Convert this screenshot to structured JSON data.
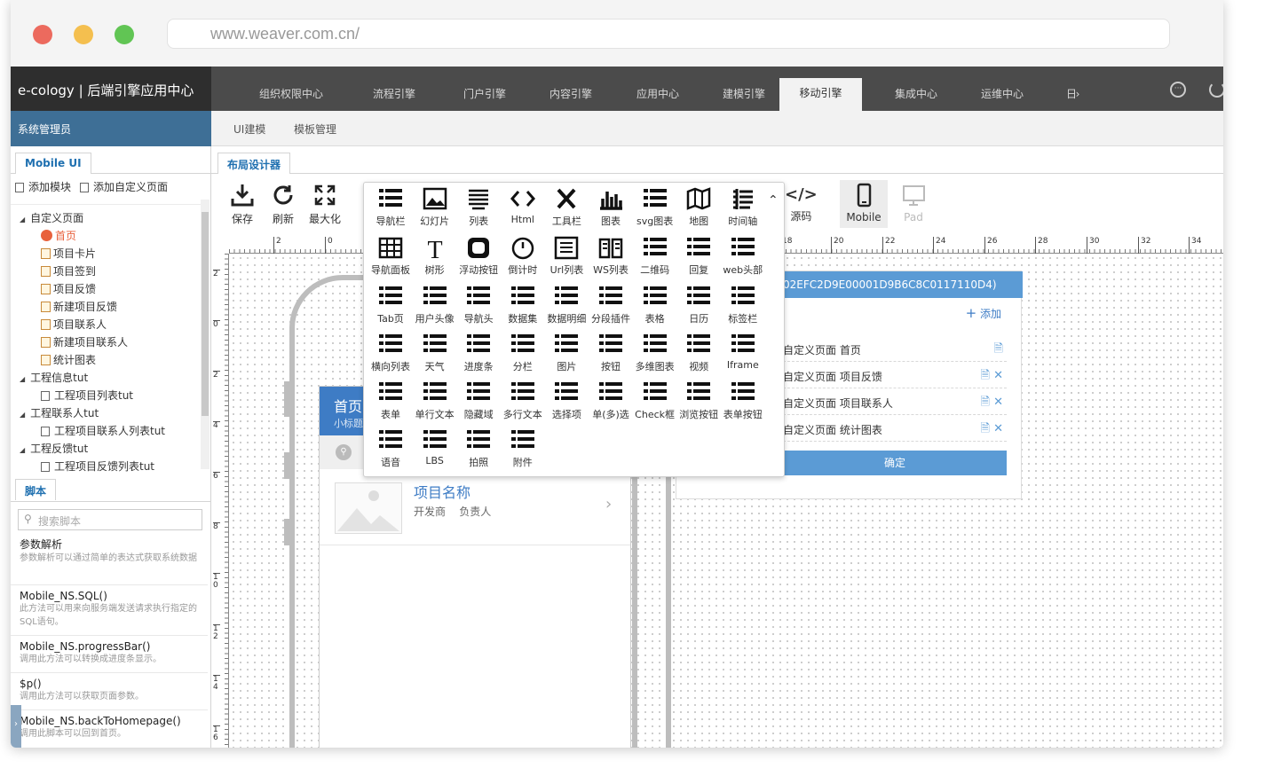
{
  "browser": {
    "url": "www.weaver.com.cn/"
  },
  "app": {
    "brand": "e-cology | 后端引擎应用中心",
    "user_menu": "系统管理员"
  },
  "nav": {
    "tabs": [
      "组织权限中心",
      "流程引擎",
      "门户引擎",
      "内容引擎",
      "应用中心",
      "建模引擎",
      "移动引擎",
      "集成中心",
      "运维中心",
      "日"
    ],
    "active_index": 6
  },
  "subnav": {
    "tabs": [
      "UI建模",
      "模板管理"
    ]
  },
  "left": {
    "tab": "Mobile UI",
    "actions": [
      "添加模块",
      "添加自定义页面"
    ],
    "tree": [
      {
        "label": "自定义页面",
        "level": 0,
        "kind": "group"
      },
      {
        "label": "首页",
        "level": 1,
        "kind": "home"
      },
      {
        "label": "项目卡片",
        "level": 1,
        "kind": "page"
      },
      {
        "label": "项目签到",
        "level": 1,
        "kind": "page"
      },
      {
        "label": "项目反馈",
        "level": 1,
        "kind": "page"
      },
      {
        "label": "新建项目反馈",
        "level": 1,
        "kind": "page"
      },
      {
        "label": "项目联系人",
        "level": 1,
        "kind": "page"
      },
      {
        "label": "新建项目联系人",
        "level": 1,
        "kind": "page"
      },
      {
        "label": "统计图表",
        "level": 1,
        "kind": "page"
      },
      {
        "label": "工程信息tut",
        "level": 0,
        "kind": "group"
      },
      {
        "label": "工程项目列表tut",
        "level": 1,
        "kind": "list"
      },
      {
        "label": "工程联系人tut",
        "level": 0,
        "kind": "group"
      },
      {
        "label": "工程项目联系人列表tut",
        "level": 1,
        "kind": "list"
      },
      {
        "label": "工程反馈tut",
        "level": 0,
        "kind": "group"
      },
      {
        "label": "工程项目反馈列表tut",
        "level": 1,
        "kind": "list"
      }
    ],
    "script_tab": "脚本",
    "search_placeholder": "搜索脚本",
    "scripts": [
      {
        "title": "参数解析",
        "desc": "参数解析可以通过简单的表达式获取系统数据"
      },
      {
        "title": "Mobile_NS.SQL()",
        "desc": "此方法可以用来向服务端发送请求执行指定的SQL语句。"
      },
      {
        "title": "Mobile_NS.progressBar()",
        "desc": "调用此方法可以转换成进度条显示。"
      },
      {
        "title": "$p()",
        "desc": "调用此方法可以获取页面参数。"
      },
      {
        "title": "Mobile_NS.backToHomepage()",
        "desc": "调用此脚本可以回到首页。"
      }
    ]
  },
  "designer": {
    "tab": "布局设计器",
    "toolbar": [
      "保存",
      "刷新",
      "最大化"
    ],
    "right_tools": [
      "源码",
      "Mobile",
      "Pad"
    ],
    "ruler_h": [
      "2",
      "0",
      "18",
      "20",
      "22",
      "24",
      "26",
      "28",
      "30",
      "32",
      "34"
    ],
    "ruler_v": [
      "2",
      "0",
      "2",
      "4",
      "6",
      "8",
      "10",
      "12",
      "14",
      "16"
    ],
    "components": [
      [
        "导航栏",
        "幻灯片",
        "列表",
        "Html",
        "工具栏",
        "图表",
        "svg图表",
        "地图",
        "时间轴"
      ],
      [
        "导航面板",
        "树形",
        "浮动按钮",
        "倒计时",
        "Url列表",
        "WS列表",
        "二维码",
        "回复",
        "web头部"
      ],
      [
        "Tab页",
        "用户头像",
        "导航头",
        "数据集",
        "数据明细",
        "分段插件",
        "表格",
        "日历",
        "标签栏"
      ],
      [
        "横向列表",
        "天气",
        "进度条",
        "分栏",
        "图片",
        "按钮",
        "多维图表",
        "视频",
        "Iframe"
      ],
      [
        "表单",
        "单行文本",
        "隐藏域",
        "多行文本",
        "选择项",
        "单(多)选",
        "Check框",
        "浏览按钮",
        "表单按钮"
      ],
      [
        "语音",
        "LBS",
        "拍照",
        "附件"
      ]
    ],
    "phone": {
      "title": "首页",
      "subtitle": "小标题",
      "item_title": "项目名称",
      "item_meta": [
        "开发商",
        "负责人"
      ]
    },
    "dialog": {
      "header": "02EFC2D9E00001D9B6C8C0117110D4)",
      "add": "添加",
      "rows": [
        "自定义页面 首页",
        "自定义页面 项目反馈",
        "自定义页面 项目联系人",
        "自定义页面 统计图表"
      ],
      "confirm": "确定"
    }
  },
  "colors": {
    "accent": "#5b9bd5",
    "sidebar_blue": "#3e6f96",
    "topbar": "#4b4b4b"
  }
}
